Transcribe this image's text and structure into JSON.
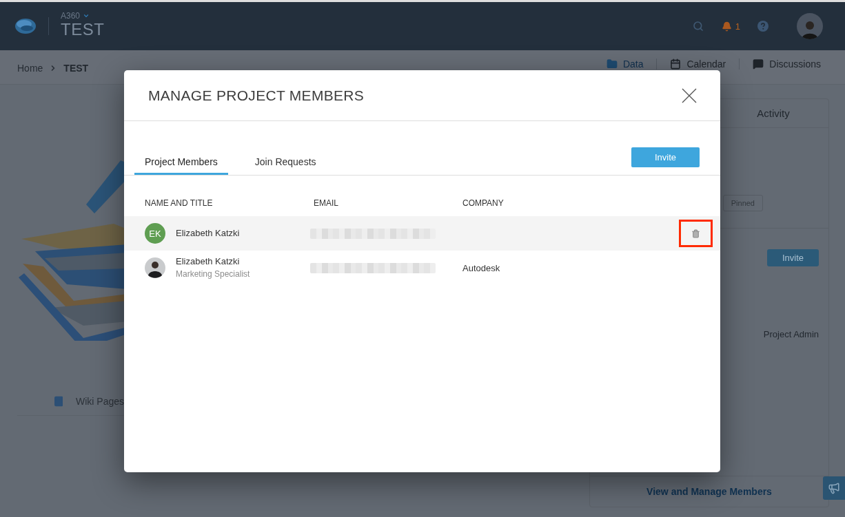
{
  "header": {
    "product": "A360",
    "project": "TEST",
    "notification_count": "1"
  },
  "breadcrumb": {
    "items": [
      "Home",
      "TEST"
    ]
  },
  "view_tabs": [
    {
      "label": "Data",
      "selected": true
    },
    {
      "label": "Calendar",
      "selected": false
    },
    {
      "label": "Discussions",
      "selected": false
    }
  ],
  "left_panel": {
    "wiki_label": "Wiki Pages"
  },
  "side_panel": {
    "tab": "Activity",
    "pinned_button": "Pinned",
    "invite_button": "Invite",
    "role": "Project Admin",
    "members_link": "View and Manage Members"
  },
  "modal": {
    "title": "MANAGE PROJECT MEMBERS",
    "tabs": [
      {
        "label": "Project Members",
        "selected": true
      },
      {
        "label": "Join Requests",
        "selected": false
      }
    ],
    "invite_button": "Invite",
    "table": {
      "columns": [
        "NAME AND TITLE",
        "EMAIL",
        "COMPANY"
      ],
      "rows": [
        {
          "avatar": {
            "kind": "initials",
            "text": "EK"
          },
          "name": "Elizabeth Katzki",
          "hovered": true,
          "delete_highlighted": true
        },
        {
          "avatar": {
            "kind": "photo"
          },
          "name": "Elizabeth Katzki",
          "title": "Marketing Specialist",
          "company": "Autodesk",
          "hovered": false,
          "delete_highlighted": false
        }
      ]
    }
  }
}
